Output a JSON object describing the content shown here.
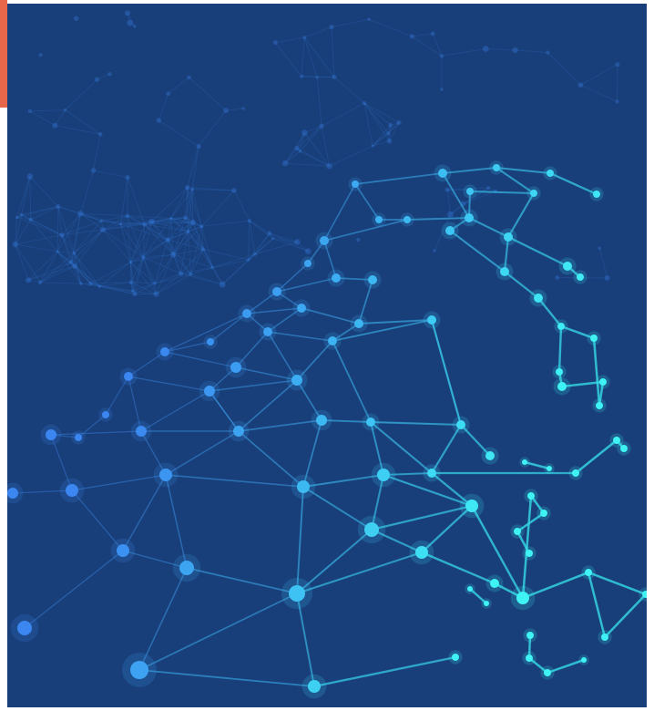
{
  "image": {
    "subject": "network-mesh-graphic",
    "colors": {
      "background": "#193f7a",
      "page": "#ffffff",
      "accent_bar": "#e8664a",
      "node_blue": "#3b86f0",
      "node_cyan": "#3ff3f5",
      "edge_blue": "#3a7fe0",
      "edge_cyan": "#34d2e0"
    }
  }
}
